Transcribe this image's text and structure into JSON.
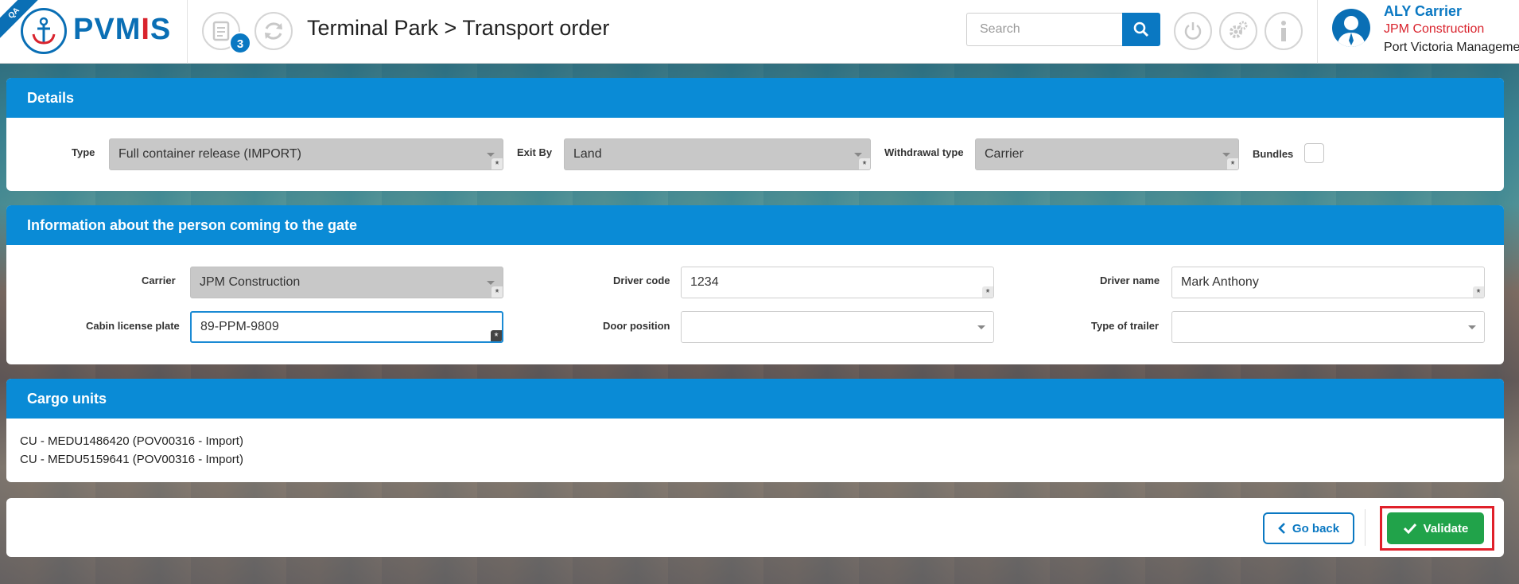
{
  "header": {
    "env_tag": "QA",
    "logo": {
      "part1": "PVM",
      "part2": "I",
      "part3": "S"
    },
    "notification_count": "3",
    "breadcrumb": "Terminal Park > Transport order",
    "search": {
      "placeholder": "Search",
      "value": ""
    },
    "user": {
      "name": "ALY Carrier",
      "company": "JPM Construction",
      "organization": "Port Victoria Management"
    }
  },
  "details": {
    "title": "Details",
    "type_label": "Type",
    "type_value": "Full container release (IMPORT)",
    "exit_by_label": "Exit By",
    "exit_by_value": "Land",
    "withdrawal_label": "Withdrawal type",
    "withdrawal_value": "Carrier",
    "bundles_label": "Bundles"
  },
  "gate_person": {
    "title": "Information about the person coming to the gate",
    "carrier_label": "Carrier",
    "carrier_value": "JPM Construction",
    "driver_code_label": "Driver code",
    "driver_code_value": "1234",
    "driver_name_label": "Driver name",
    "driver_name_value": "Mark Anthony",
    "cabin_plate_label": "Cabin license plate",
    "cabin_plate_value": "89-PPM-9809",
    "door_position_label": "Door position",
    "door_position_value": "",
    "trailer_type_label": "Type of trailer",
    "trailer_type_value": ""
  },
  "cargo": {
    "title": "Cargo units",
    "items": [
      "CU - MEDU1486420 (POV00316 - Import)",
      "CU - MEDU5159641 (POV00316 - Import)"
    ]
  },
  "actions": {
    "back_label": "Go back",
    "validate_label": "Validate"
  },
  "colors": {
    "primary": "#0a78c2",
    "panel_header": "#0a8bd6",
    "brand_red": "#d9232d",
    "validate": "#21a34a",
    "highlight": "#e0202a"
  },
  "required_marker": "*"
}
